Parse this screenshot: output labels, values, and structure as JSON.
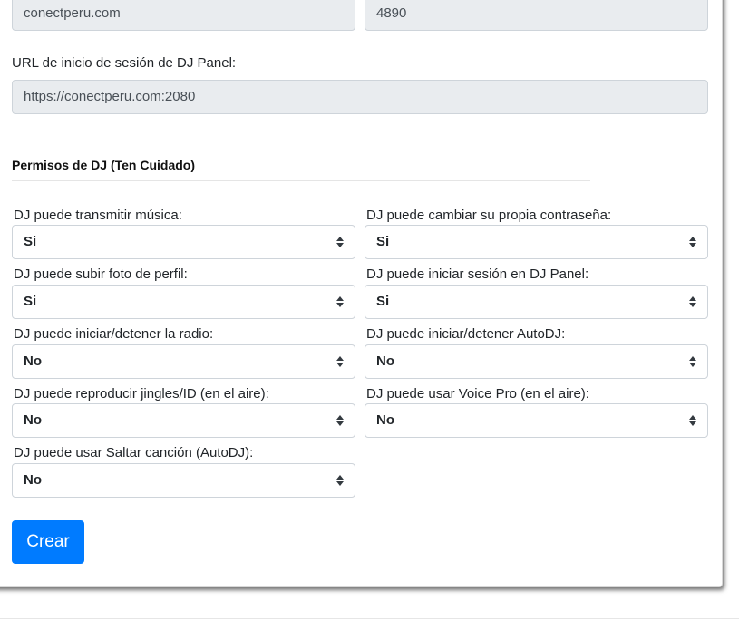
{
  "top_fields": {
    "host_value": "conectperu.com",
    "port_value": "4890"
  },
  "login_url": {
    "label": "URL de inicio de sesión de DJ Panel:",
    "value": "https://conectperu.com:2080"
  },
  "permissions": {
    "title": "Permisos de DJ (Ten Cuidado)",
    "items": [
      {
        "label": "DJ puede transmitir música:",
        "value": "Si"
      },
      {
        "label": "DJ puede cambiar su propia contraseña:",
        "value": "Si"
      },
      {
        "label": "DJ puede subir foto de perfil:",
        "value": "Si"
      },
      {
        "label": "DJ puede iniciar sesión en DJ Panel:",
        "value": "Si"
      },
      {
        "label": "DJ puede iniciar/detener la radio:",
        "value": "No"
      },
      {
        "label": "DJ puede iniciar/detener AutoDJ:",
        "value": "No"
      },
      {
        "label": "DJ puede reproducir jingles/ID (en el aire):",
        "value": "No"
      },
      {
        "label": "DJ puede usar Voice Pro (en el aire):",
        "value": "No"
      },
      {
        "label": "DJ puede usar Saltar canción (AutoDJ):",
        "value": "No"
      }
    ]
  },
  "actions": {
    "create_label": "Crear"
  },
  "colors": {
    "primary": "#007bff",
    "readonly_bg": "#e9ecef",
    "border": "#ced4da"
  }
}
